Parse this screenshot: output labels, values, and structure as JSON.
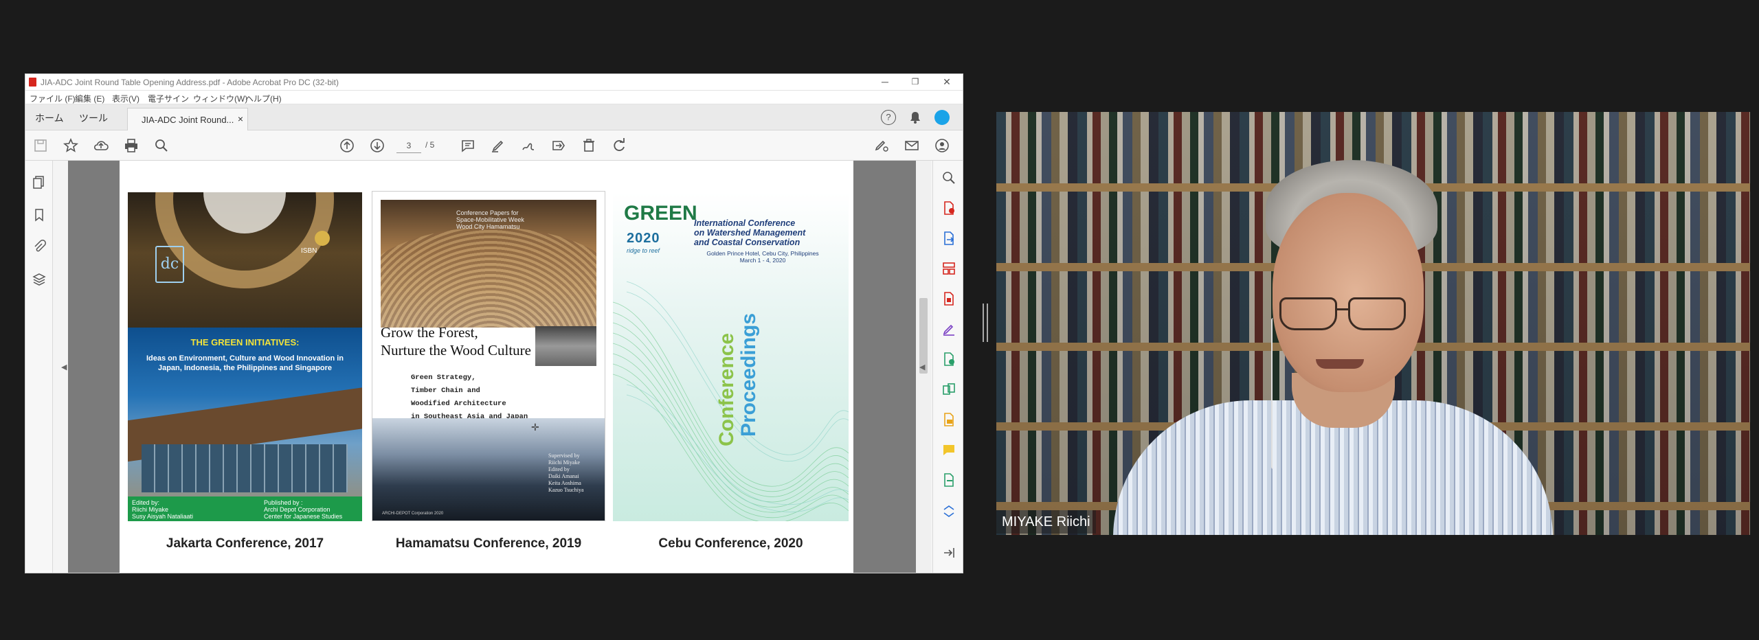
{
  "window": {
    "title": "JIA-ADC Joint Round Table Opening Address.pdf - Adobe Acrobat Pro DC (32-bit)",
    "minimize": "─",
    "restore": "❐",
    "close": "✕"
  },
  "menu": [
    "ファイル (F)",
    "編集 (E)",
    "表示(V)",
    "電子サイン",
    "ウィンドウ(W)",
    "ヘルプ(H)"
  ],
  "tabs": {
    "home": "ホーム",
    "tools": "ツール",
    "document": "JIA-ADC Joint Round...",
    "close": "×"
  },
  "help_icon": "?",
  "toolbar": {
    "page_current": "3",
    "page_total": "/ 5"
  },
  "covers": {
    "jakarta": {
      "isbn": "ISBN",
      "title": "THE GREEN INITIATIVES:",
      "subtitle": "Ideas on Environment, Culture and Wood Innovation in Japan, Indonesia, the Philippines and Singapore",
      "edited_by": "Edited by:",
      "editors": "Riichi Miyake\nSusy Aisyah Nataliaati",
      "published_by": "Published by :",
      "publishers": "Archi Depot Corporation\nCenter for Japanese Studies",
      "caption": "Jakarta Conference, 2017"
    },
    "hamamatsu": {
      "top_text": "Conference Papers for\nSpace-Mobilitative Week\nWood City Hamamatsu",
      "title_line1": "Grow the Forest,",
      "title_line2": "Nurture the Wood Culture",
      "subtitle_lines": [
        "Green Strategy,",
        "Timber Chain and",
        "Woodified Architecture",
        "in Southeast Asia and Japan"
      ],
      "edited": "Supervised by\nRiichi Miyake\nEdited by\nDaiki Amanai\nKeita Aoshima\nKazuo Tsuchiya",
      "publisher": "ARCHI-DEPOT Corporation 2020",
      "caption": "Hamamatsu Conference, 2019"
    },
    "cebu": {
      "logo_word": "GREEN",
      "logo_year": "2020",
      "logo_tag": "ridge to reef",
      "title": "International Conference\non Watershed Management\nand Coastal Conservation",
      "location": "Golden Prince Hotel, Cebu City, Philippines\nMarch 1 - 4, 2020",
      "proceedings_1": "Conference",
      "proceedings_2": "Proceedings",
      "caption": "Cebu Conference, 2020"
    }
  },
  "video": {
    "participant_name": "MIYAKE Riichi"
  },
  "colors": {
    "acrobat_red": "#d6261e",
    "accent_blue": "#1aa3e8",
    "zoom_bg": "#1b1b1b"
  }
}
